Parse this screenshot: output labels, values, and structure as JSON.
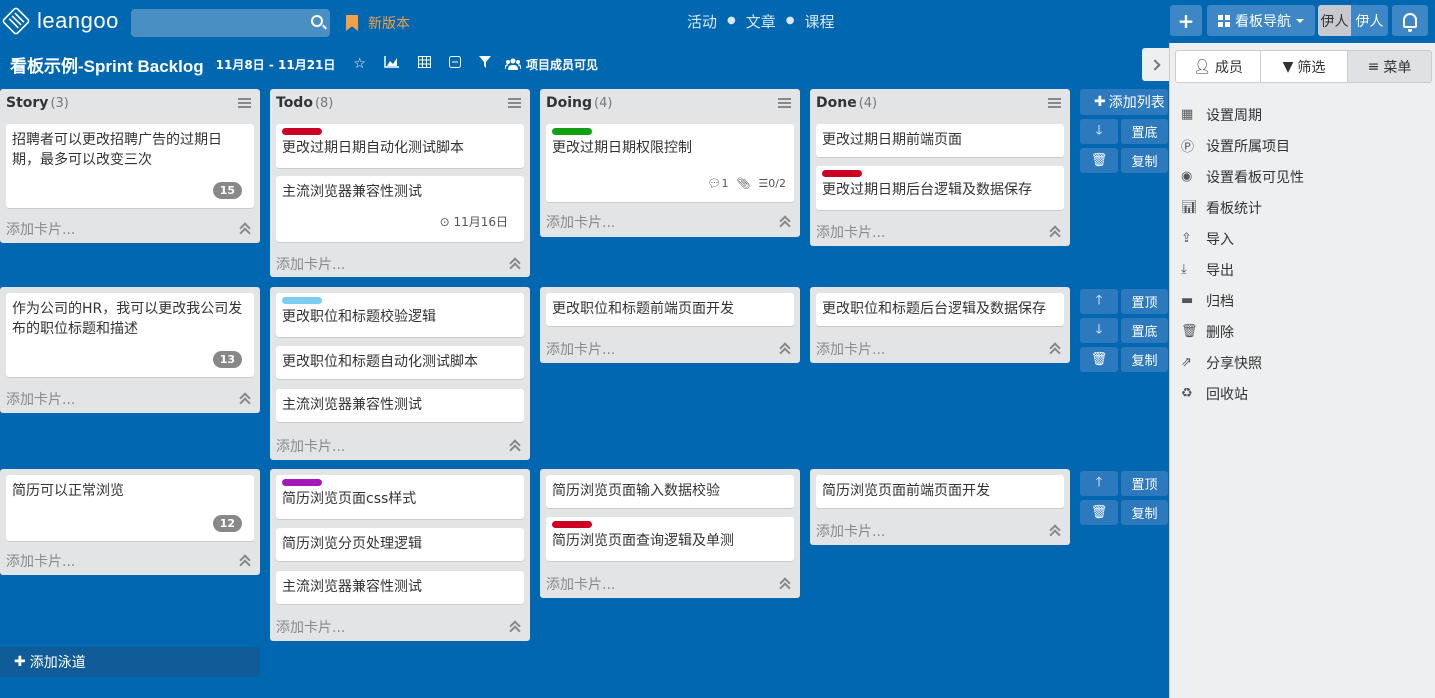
{
  "topnav": {
    "logo": "leangoo",
    "search_placeholder": "",
    "new_version": "新版本",
    "center_links": [
      "活动",
      "文章",
      "课程"
    ],
    "plus": "+",
    "board_nav": "看板导航",
    "user1": "伊人",
    "user2": "伊人"
  },
  "board": {
    "title": "看板示例-Sprint Backlog",
    "dates": "11月8日 - 11月21日",
    "visibility": "项目成员可见"
  },
  "columns": [
    {
      "name": "Story",
      "count": "(3)"
    },
    {
      "name": "Todo",
      "count": "(8)"
    },
    {
      "name": "Doing",
      "count": "(4)"
    },
    {
      "name": "Done",
      "count": "(4)"
    }
  ],
  "add_card": "添加卡片...",
  "add_list": "添加列表",
  "add_lane": "添加泳道",
  "lane_controls": {
    "top": "置顶",
    "bottom": "置底",
    "copy": "复制"
  },
  "lanes": [
    {
      "story": {
        "text": "招聘者可以更改招聘广告的过期日期，最多可以改变三次",
        "badge": "15"
      },
      "todo": [
        {
          "text": "更改过期日期自动化测试脚本",
          "label": "#cc0022"
        },
        {
          "text": "主流浏览器兼容性测试",
          "due": "11月16日"
        }
      ],
      "doing": [
        {
          "text": "更改过期日期权限控制",
          "label": "#10a010",
          "comments": "1",
          "checklist": "0/2"
        }
      ],
      "done": [
        {
          "text": "更改过期日期前端页面"
        },
        {
          "text": "更改过期日期后台逻辑及数据保存",
          "label": "#cc0022"
        }
      ]
    },
    {
      "story": {
        "text": "作为公司的HR，我可以更改我公司发布的职位标题和描述",
        "badge": "13"
      },
      "todo": [
        {
          "text": "更改职位和标题校验逻辑",
          "label": "#79cdee"
        },
        {
          "text": "更改职位和标题自动化测试脚本"
        },
        {
          "text": "主流浏览器兼容性测试"
        }
      ],
      "doing": [
        {
          "text": "更改职位和标题前端页面开发"
        }
      ],
      "done": [
        {
          "text": "更改职位和标题后台逻辑及数据保存"
        }
      ]
    },
    {
      "story": {
        "text": "简历可以正常浏览",
        "badge": "12"
      },
      "todo": [
        {
          "text": "简历浏览页面css样式",
          "label": "#a21ab8"
        },
        {
          "text": "简历浏览分页处理逻辑"
        },
        {
          "text": "主流浏览器兼容性测试"
        }
      ],
      "doing": [
        {
          "text": "简历浏览页面输入数据校验"
        },
        {
          "text": "简历浏览页面查询逻辑及单测",
          "label": "#cc0022"
        }
      ],
      "done": [
        {
          "text": "简历浏览页面前端页面开发"
        }
      ]
    }
  ],
  "panel": {
    "tabs": [
      "成员",
      "筛选",
      "菜单"
    ],
    "menu": [
      {
        "label": "设置周期",
        "icon": "calendar-icon"
      },
      {
        "label": "设置所属项目",
        "icon": "project-icon"
      },
      {
        "label": "设置看板可见性",
        "icon": "eye-icon"
      },
      {
        "label": "看板统计",
        "icon": "chart-icon"
      },
      {
        "label": "导入",
        "icon": "upload-icon"
      },
      {
        "label": "导出",
        "icon": "download-icon"
      },
      {
        "label": "归档",
        "icon": "archive-icon"
      },
      {
        "label": "删除",
        "icon": "trash-icon"
      },
      {
        "label": "分享快照",
        "icon": "share-icon"
      },
      {
        "label": "回收站",
        "icon": "recycle-icon"
      }
    ]
  }
}
